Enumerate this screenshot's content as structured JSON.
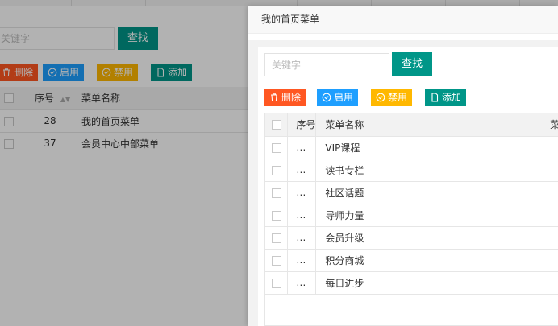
{
  "background": {
    "search": {
      "placeholder": "关键字",
      "button": "查找"
    },
    "toolbar": {
      "delete": "删除",
      "enable": "启用",
      "disable": "禁用",
      "add": "添加"
    },
    "table": {
      "col_no": "序号",
      "col_name": "菜单名称",
      "rows": [
        {
          "no": "28",
          "name": "我的首页菜单"
        },
        {
          "no": "37",
          "name": "会员中心中部菜单"
        }
      ]
    }
  },
  "modal": {
    "title": "我的首页菜单",
    "search": {
      "placeholder": "关键字",
      "button": "查找"
    },
    "toolbar": {
      "delete": "删除",
      "enable": "启用",
      "disable": "禁用",
      "add": "添加"
    },
    "table": {
      "col_no": "序号",
      "col_name": "菜单名称",
      "col_more": "菜",
      "rows": [
        {
          "no": "…",
          "name": "VIP课程"
        },
        {
          "no": "…",
          "name": "读书专栏"
        },
        {
          "no": "…",
          "name": "社区话题"
        },
        {
          "no": "…",
          "name": "导师力量"
        },
        {
          "no": "…",
          "name": "会员升级"
        },
        {
          "no": "…",
          "name": "积分商城"
        },
        {
          "no": "…",
          "name": "每日进步"
        }
      ]
    }
  },
  "colors": {
    "primary": "#009688",
    "danger": "#ff5722",
    "info": "#1e9fff",
    "warning": "#ffb800"
  }
}
